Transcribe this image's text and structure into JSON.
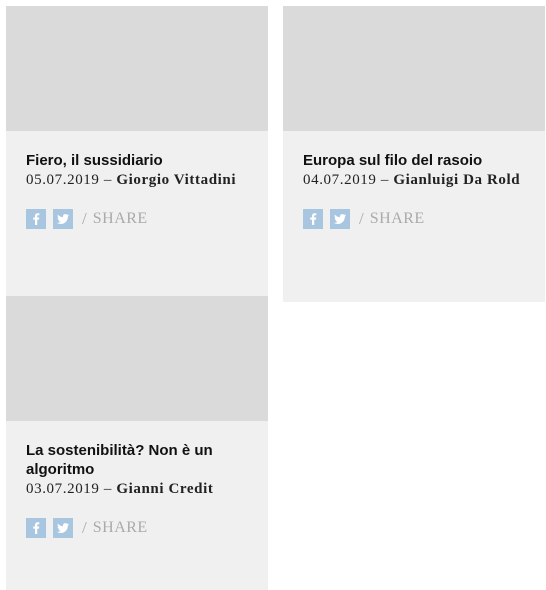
{
  "articles": [
    {
      "title": "Fiero, il sussidiario",
      "date": "05.07.2019",
      "separator": "–",
      "author": "Giorgio Vittadini",
      "share_slash": "/",
      "share_label": "SHARE"
    },
    {
      "title": "Europa sul filo del rasoio",
      "date": "04.07.2019",
      "separator": "–",
      "author": "Gianluigi Da Rold",
      "share_slash": "/",
      "share_label": "SHARE"
    },
    {
      "title": "La sostenibilità? Non è un algoritmo",
      "date": "03.07.2019",
      "separator": "–",
      "author": "Gianni Credit",
      "share_slash": "/",
      "share_label": "SHARE"
    }
  ],
  "icons": {
    "facebook": "facebook-icon",
    "twitter": "twitter-icon"
  },
  "colors": {
    "card_bg": "#f0f0f0",
    "thumb_bg": "#dadada",
    "social_icon": "#a9c6e0",
    "share_text": "#aaaaaa"
  }
}
